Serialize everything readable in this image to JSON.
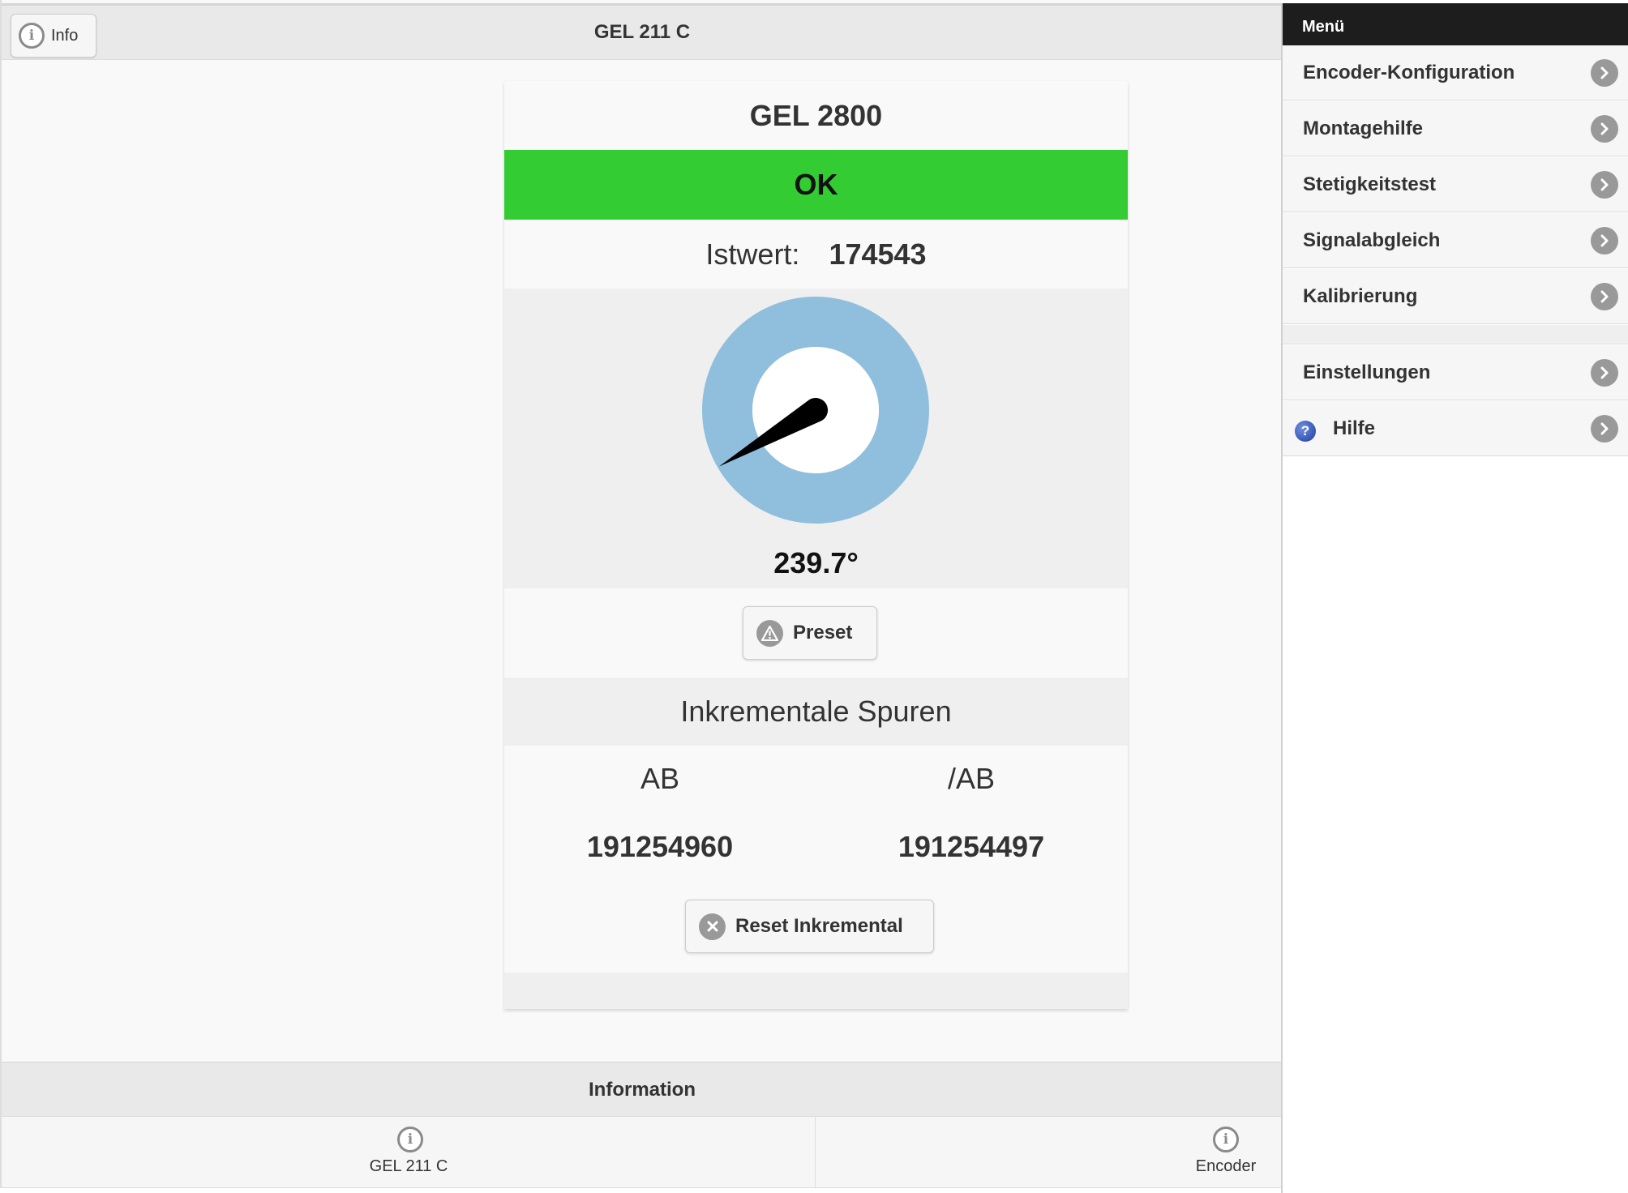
{
  "header": {
    "info_button_label": "Info",
    "title": "GEL 211 C"
  },
  "card": {
    "device_name": "GEL 2800",
    "status": "OK",
    "status_color": "#33cc33",
    "istwert_label": "Istwert:",
    "istwert_value": "174543",
    "gauge": {
      "angle_deg": 239.7,
      "angle_display": "239.7°",
      "ring_color": "#8fbfdc",
      "needle_color": "#000000"
    },
    "preset_label": "Preset",
    "incremental": {
      "heading": "Inkrementale Spuren",
      "tracks": [
        {
          "name": "AB",
          "value": "191254960"
        },
        {
          "name": "/AB",
          "value": "191254497"
        }
      ],
      "reset_label": "Reset Inkremental"
    }
  },
  "footer": {
    "title": "Information",
    "tabs": [
      {
        "label": "GEL 211 C",
        "icon": "info-icon"
      },
      {
        "label": "Encoder",
        "icon": "info-icon"
      }
    ]
  },
  "menu": {
    "header": "Menü",
    "items": [
      {
        "label": "Encoder-Konfiguration"
      },
      {
        "label": "Montagehilfe"
      },
      {
        "label": "Stetigkeitstest"
      },
      {
        "label": "Signalabgleich"
      },
      {
        "label": "Kalibrierung"
      }
    ],
    "secondary_items": [
      {
        "label": "Einstellungen"
      },
      {
        "label": "Hilfe",
        "icon": "help-icon"
      }
    ]
  }
}
